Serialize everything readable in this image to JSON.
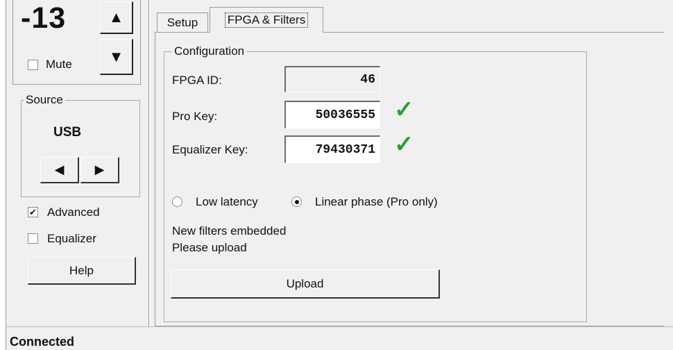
{
  "volume": {
    "value": "-13",
    "up_icon": "triangle-up",
    "down_icon": "triangle-down",
    "mute_label": "Mute",
    "mute_checked": false
  },
  "source": {
    "legend": "Source",
    "value": "USB",
    "prev_icon": "triangle-left",
    "next_icon": "triangle-right"
  },
  "options": {
    "advanced_label": "Advanced",
    "advanced_checked": true,
    "equalizer_label": "Equalizer",
    "equalizer_checked": false
  },
  "help_label": "Help",
  "tabs": [
    {
      "label": "Setup",
      "active": false
    },
    {
      "label": "FPGA & Filters",
      "active": true
    }
  ],
  "config": {
    "legend": "Configuration",
    "fpga_id": {
      "label": "FPGA ID:",
      "value": "46"
    },
    "pro_key": {
      "label": "Pro Key:",
      "value": "50036555",
      "valid": true
    },
    "eq_key": {
      "label": "Equalizer Key:",
      "value": "79430371",
      "valid": true
    },
    "check_glyph": "✓"
  },
  "latency": {
    "low_label": "Low latency",
    "linear_label": "Linear phase (Pro only)",
    "selected": "linear"
  },
  "messages": {
    "line1": "New filters embedded",
    "line2": "Please upload"
  },
  "upload_label": "Upload",
  "status": "Connected",
  "colors": {
    "background": "#f0f0f0",
    "check_green": "#2e9d2e"
  }
}
